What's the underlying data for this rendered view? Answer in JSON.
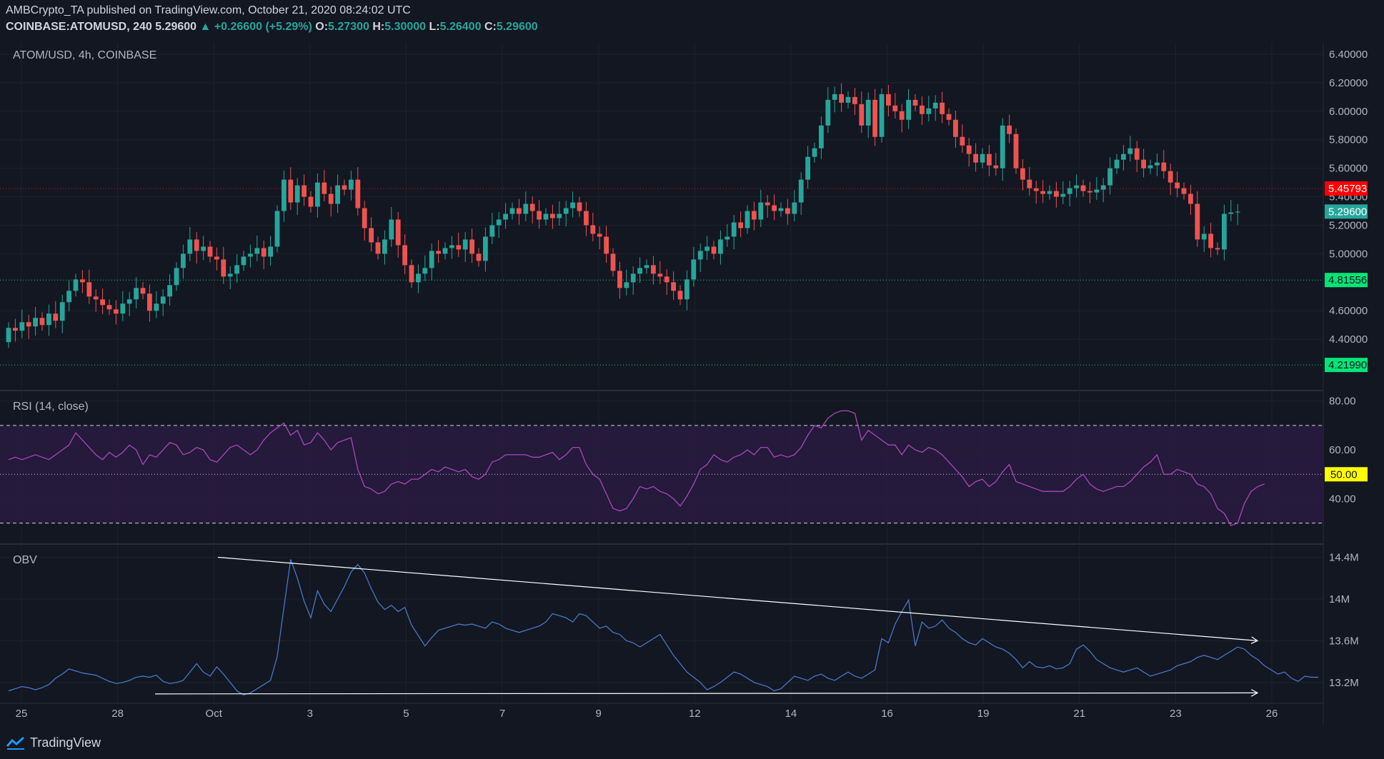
{
  "header": {
    "line1": "AMBCrypto_TA published on TradingView.com, October 21, 2020 08:24:02 UTC",
    "symbol": "COINBASE:ATOMUSD, 240",
    "last": "5.29600",
    "change": "▲ +0.26600 (+5.29%)",
    "o_label": "O:",
    "o": "5.27300",
    "h_label": "H:",
    "h": "5.30000",
    "l_label": "L:",
    "l": "5.26400",
    "c_label": "C:",
    "c": "5.29600"
  },
  "footer": {
    "brand": "TradingView",
    "logo_icon": "tradingview-logo-icon"
  },
  "colors": {
    "background": "#131722",
    "up": "#26a69a",
    "down": "#ef5350",
    "rsi": "#ab47bc",
    "rsi_band": "#2a1a44",
    "obv": "#4a7fd4",
    "resistance": "#ff0000",
    "support": "#00e676",
    "midline_label": "#ffff00"
  },
  "chart_data": [
    {
      "type": "candlestick",
      "title": "ATOM/USD, 4h, COINBASE",
      "x_ticks": [
        "25",
        "28",
        "Oct",
        "3",
        "5",
        "7",
        "9",
        "12",
        "14",
        "16",
        "19",
        "21",
        "23",
        "26"
      ],
      "y_ticks": [
        "4.40000",
        "4.60000",
        "5.00000",
        "5.20000",
        "5.40000",
        "5.60000",
        "5.80000",
        "6.00000",
        "6.20000",
        "6.40000"
      ],
      "ylim": [
        4.05,
        6.48
      ],
      "last_price": 5.296,
      "price_labels": [
        {
          "value": 5.45793,
          "text": "5.45793",
          "color": "#ff0000"
        },
        {
          "value": 5.296,
          "text": "5.29600",
          "color": "#26a69a"
        },
        {
          "value": 4.81556,
          "text": "4.81556",
          "color": "#00e676"
        },
        {
          "value": 4.2199,
          "text": "4.21990",
          "color": "#00e676"
        }
      ],
      "horizontal_lines": [
        {
          "value": 5.45793,
          "color": "#ff0000",
          "style": "dotted"
        },
        {
          "value": 4.81556,
          "color": "#00e676",
          "style": "dotted"
        },
        {
          "value": 4.2199,
          "color": "#00e676",
          "style": "dotted"
        }
      ],
      "close": [
        4.48,
        4.46,
        4.52,
        4.49,
        4.55,
        4.5,
        4.58,
        4.53,
        4.66,
        4.74,
        4.82,
        4.8,
        4.7,
        4.68,
        4.64,
        4.61,
        4.58,
        4.65,
        4.68,
        4.76,
        4.72,
        4.6,
        4.65,
        4.7,
        4.78,
        4.9,
        5.0,
        5.1,
        5.02,
        5.05,
        4.98,
        4.96,
        4.84,
        4.86,
        4.92,
        4.98,
        5.0,
        5.04,
        4.98,
        5.05,
        5.3,
        5.52,
        5.36,
        5.48,
        5.4,
        5.33,
        5.5,
        5.42,
        5.35,
        5.48,
        5.45,
        5.52,
        5.32,
        5.18,
        5.08,
        5.0,
        5.1,
        5.24,
        5.06,
        4.92,
        4.8,
        4.86,
        4.9,
        5.02,
        5.0,
        5.04,
        5.06,
        5.03,
        5.1,
        5.0,
        4.95,
        5.12,
        5.2,
        5.24,
        5.28,
        5.32,
        5.28,
        5.35,
        5.3,
        5.24,
        5.28,
        5.25,
        5.28,
        5.32,
        5.36,
        5.3,
        5.2,
        5.14,
        5.12,
        5.0,
        4.88,
        4.76,
        4.8,
        4.86,
        4.9,
        4.92,
        4.86,
        4.84,
        4.8,
        4.74,
        4.68,
        4.82,
        4.96,
        5.02,
        5.05,
        5.0,
        5.1,
        5.12,
        5.22,
        5.18,
        5.3,
        5.24,
        5.36,
        5.34,
        5.3,
        5.32,
        5.28,
        5.36,
        5.52,
        5.68,
        5.74,
        5.9,
        6.08,
        6.12,
        6.06,
        6.1,
        6.05,
        5.9,
        6.08,
        5.82,
        6.12,
        6.04,
        6.0,
        5.94,
        6.08,
        6.04,
        5.98,
        6.02,
        6.06,
        5.98,
        5.94,
        5.82,
        5.76,
        5.7,
        5.64,
        5.7,
        5.62,
        5.6,
        5.9,
        5.84,
        5.6,
        5.52,
        5.46,
        5.44,
        5.42,
        5.44,
        5.4,
        5.42,
        5.46,
        5.48,
        5.44,
        5.43,
        5.45,
        5.48,
        5.6,
        5.66,
        5.7,
        5.74,
        5.66,
        5.6,
        5.62,
        5.64,
        5.58,
        5.5,
        5.46,
        5.42,
        5.35,
        5.1,
        5.14,
        5.04,
        5.03,
        5.28,
        5.29,
        5.296
      ],
      "volume_note": ""
    },
    {
      "type": "line",
      "title": "RSI (14, close)",
      "y_ticks": [
        "40.00",
        "60.00",
        "80.00"
      ],
      "ylim": [
        22,
        84
      ],
      "band": [
        30,
        70
      ],
      "midline": 50,
      "midline_label": "50.00",
      "values": [
        56,
        57,
        56,
        57,
        58,
        57,
        56,
        58,
        60,
        62,
        67,
        64,
        61,
        58,
        56,
        59,
        57,
        59,
        62,
        60,
        54,
        58,
        57,
        60,
        63,
        62,
        58,
        59,
        61,
        60,
        56,
        55,
        58,
        61,
        62,
        60,
        58,
        60,
        64,
        67,
        69,
        71,
        66,
        68,
        62,
        63,
        67,
        64,
        60,
        63,
        64,
        65,
        52,
        45,
        44,
        42,
        43,
        46,
        47,
        46,
        48,
        48,
        50,
        52,
        51,
        53,
        52,
        51,
        52,
        49,
        48,
        50,
        55,
        56,
        58,
        58,
        58,
        58,
        57,
        57,
        58,
        59,
        56,
        58,
        61,
        61,
        54,
        50,
        48,
        42,
        36,
        35,
        36,
        40,
        45,
        44,
        45,
        43,
        42,
        40,
        37,
        41,
        46,
        52,
        54,
        58,
        56,
        55,
        57,
        58,
        60,
        58,
        61,
        61,
        57,
        58,
        57,
        58,
        61,
        66,
        70,
        69,
        73,
        75,
        76,
        76,
        75,
        64,
        68,
        66,
        64,
        62,
        62,
        58,
        62,
        60,
        59,
        61,
        60,
        58,
        55,
        52,
        49,
        45,
        47,
        48,
        45,
        47,
        51,
        54,
        47,
        46,
        45,
        44,
        43,
        43,
        43,
        43,
        45,
        48,
        50,
        46,
        44,
        43,
        44,
        45,
        45,
        47,
        50,
        53,
        55,
        58,
        50,
        50,
        52,
        51,
        50,
        46,
        45,
        42,
        36,
        34,
        29,
        30,
        38,
        43,
        45,
        46
      ]
    },
    {
      "type": "line",
      "title": "OBV",
      "y_ticks": [
        "13.2M",
        "13.6M",
        "14M",
        "14.4M"
      ],
      "ylim": [
        13.0,
        14.52
      ],
      "values": [
        13.12,
        13.14,
        13.16,
        13.15,
        13.13,
        13.15,
        13.18,
        13.24,
        13.28,
        13.33,
        13.31,
        13.29,
        13.28,
        13.27,
        13.24,
        13.21,
        13.19,
        13.2,
        13.22,
        13.25,
        13.26,
        13.25,
        13.27,
        13.21,
        13.19,
        13.2,
        13.22,
        13.3,
        13.38,
        13.3,
        13.26,
        13.35,
        13.28,
        13.2,
        13.12,
        13.08,
        13.1,
        13.14,
        13.18,
        13.22,
        13.45,
        13.92,
        14.38,
        14.2,
        13.98,
        13.82,
        14.08,
        13.95,
        13.88,
        14.0,
        14.12,
        14.26,
        14.33,
        14.25,
        14.1,
        13.97,
        13.9,
        13.94,
        13.88,
        13.92,
        13.75,
        13.65,
        13.55,
        13.63,
        13.7,
        13.72,
        13.74,
        13.76,
        13.75,
        13.76,
        13.74,
        13.72,
        13.78,
        13.76,
        13.72,
        13.7,
        13.68,
        13.7,
        13.72,
        13.74,
        13.78,
        13.86,
        13.84,
        13.82,
        13.78,
        13.86,
        13.84,
        13.78,
        13.72,
        13.74,
        13.68,
        13.66,
        13.6,
        13.58,
        13.54,
        13.58,
        13.62,
        13.66,
        13.56,
        13.46,
        13.38,
        13.3,
        13.25,
        13.2,
        13.13,
        13.16,
        13.2,
        13.25,
        13.3,
        13.28,
        13.24,
        13.2,
        13.18,
        13.16,
        13.12,
        13.14,
        13.2,
        13.26,
        13.24,
        13.22,
        13.26,
        13.28,
        13.24,
        13.22,
        13.26,
        13.3,
        13.26,
        13.24,
        13.28,
        13.32,
        13.62,
        13.58,
        13.76,
        13.88,
        13.99,
        13.55,
        13.78,
        13.72,
        13.74,
        13.8,
        13.72,
        13.68,
        13.62,
        13.58,
        13.56,
        13.62,
        13.58,
        13.54,
        13.52,
        13.48,
        13.42,
        13.34,
        13.4,
        13.35,
        13.34,
        13.36,
        13.33,
        13.34,
        13.38,
        13.52,
        13.56,
        13.5,
        13.42,
        13.38,
        13.34,
        13.32,
        13.3,
        13.32,
        13.34,
        13.3,
        13.26,
        13.28,
        13.3,
        13.32,
        13.36,
        13.38,
        13.4,
        13.44,
        13.46,
        13.44,
        13.42,
        13.46,
        13.5,
        13.54,
        13.52,
        13.46,
        13.42,
        13.36,
        13.32,
        13.28,
        13.3,
        13.24,
        13.21,
        13.26,
        13.25,
        13.25
      ],
      "trendlines": [
        {
          "from_x": 0.17,
          "from_y": 14.4,
          "to_x": 1.0,
          "to_y": 13.6,
          "color": "#ffffff"
        },
        {
          "from_x": 0.0,
          "from_y": 13.09,
          "to_x": 1.0,
          "to_y": 13.1,
          "color": "#ffffff"
        }
      ]
    }
  ]
}
